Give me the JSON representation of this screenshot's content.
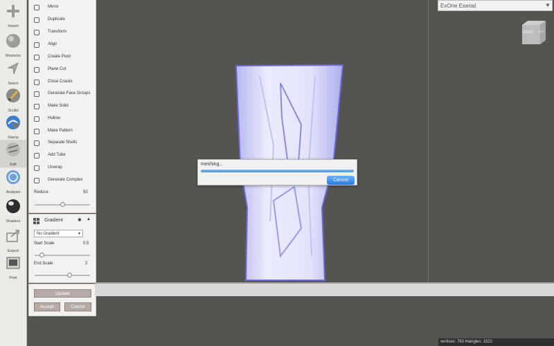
{
  "toolbar": {
    "items": [
      {
        "label": "Import",
        "icon": "plus-icon"
      },
      {
        "label": "Meshmix",
        "icon": "sphere-icon"
      },
      {
        "label": "Select",
        "icon": "arrow-icon"
      },
      {
        "label": "Sculpt",
        "icon": "brush-icon"
      },
      {
        "label": "Stamp",
        "icon": "stamp-icon"
      },
      {
        "label": "Edit",
        "icon": "edit-icon"
      },
      {
        "label": "Analysis",
        "icon": "analysis-icon"
      },
      {
        "label": "Shaders",
        "icon": "shader-ball-icon"
      },
      {
        "label": "Export",
        "icon": "export-icon"
      },
      {
        "label": "Print",
        "icon": "printer-icon"
      }
    ]
  },
  "edit_menu": {
    "items": [
      "Mirror",
      "Duplicate",
      "Transform",
      "Align",
      "Create Pivot",
      "Plane Cut",
      "Close Cracks",
      "Generate Face Groups",
      "Make Solid",
      "Hollow",
      "Make Pattern",
      "Separate Shells",
      "Add Tube",
      "Unwrap",
      "Generate Complex"
    ],
    "reduce_label": "Reduce",
    "reduce_value": "50"
  },
  "gradient_panel": {
    "title": "Gradient",
    "dropdown_value": "No Gradient",
    "start_scale_label": "Start Scale",
    "start_scale_value": "0.5",
    "end_scale_label": "End Scale",
    "end_scale_value": "2"
  },
  "actions": {
    "update": "Update",
    "accept": "Accept",
    "cancel": "Cancel"
  },
  "printer": {
    "name": "ExOne Exerial"
  },
  "viewcube": {
    "front": "FRONT",
    "top": "TOP"
  },
  "dialog": {
    "message": "meshing...",
    "cancel": "Cancel"
  },
  "status": {
    "text": "vertices: 763 triangles: 1522"
  },
  "colors": {
    "viewport_bg": "#565450",
    "accent_blue": "#2a7be2",
    "model": "#dcdcf8"
  }
}
